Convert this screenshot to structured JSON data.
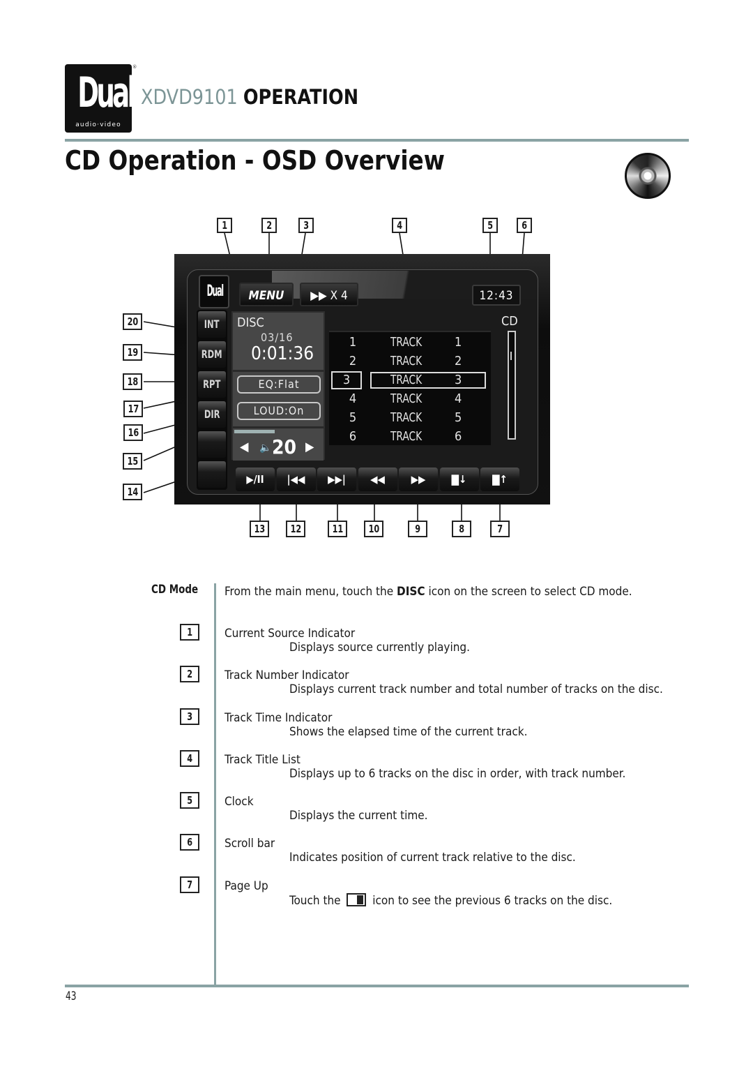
{
  "header": {
    "brand": "Dual",
    "brand_sub": "audio·video",
    "registered_mark": "®",
    "model": "XDVD9101",
    "section": "OPERATION",
    "page_title": "CD Operation - OSD Overview",
    "section_icon": "cd-disc-icon"
  },
  "osd": {
    "logo": "Dual",
    "menu_label": "MENU",
    "ff_icon": "fast-forward-icon",
    "ff_label": "X 4",
    "clock": "12:43",
    "source_badge": "CD",
    "side_buttons": [
      "INT",
      "RDM",
      "RPT",
      "DIR",
      "",
      ""
    ],
    "disc_label": "DISC",
    "track_indicator": "03/16",
    "elapsed_time": "0:01:36",
    "eq_label": "EQ:Flat",
    "loud_label": "LOUD:On",
    "volume": "20",
    "volume_level_fraction": 0.4,
    "tracks": [
      {
        "num": "1",
        "title": "TRACK",
        "idx": "1",
        "selected": false
      },
      {
        "num": "2",
        "title": "TRACK",
        "idx": "2",
        "selected": false
      },
      {
        "num": "3",
        "title": "TRACK",
        "idx": "3",
        "selected": true
      },
      {
        "num": "4",
        "title": "TRACK",
        "idx": "4",
        "selected": false
      },
      {
        "num": "5",
        "title": "TRACK",
        "idx": "5",
        "selected": false
      },
      {
        "num": "6",
        "title": "TRACK",
        "idx": "6",
        "selected": false
      }
    ],
    "scroll_position_fraction": 0.2,
    "controls": [
      {
        "name": "play-pause",
        "glyph": "▶/II"
      },
      {
        "name": "previous-track",
        "glyph": "|◀◀"
      },
      {
        "name": "next-track",
        "glyph": "▶▶|"
      },
      {
        "name": "rewind",
        "glyph": "◀◀"
      },
      {
        "name": "fast-forward",
        "glyph": "▶▶"
      },
      {
        "name": "page-down",
        "glyph": "▇↓"
      },
      {
        "name": "page-up",
        "glyph": "▇↑"
      }
    ]
  },
  "callouts": {
    "top": [
      "1",
      "2",
      "3",
      "4",
      "5",
      "6"
    ],
    "bottom": [
      "13",
      "12",
      "11",
      "10",
      "9",
      "8",
      "7"
    ],
    "left": [
      "20",
      "19",
      "18",
      "17",
      "16",
      "15",
      "14"
    ]
  },
  "description": {
    "mode_label": "CD Mode",
    "intro_prefix": "From the main menu, touch the ",
    "intro_bold": "DISC",
    "intro_suffix": " icon on the screen to select CD mode.",
    "items": [
      {
        "num": "1",
        "title": "Current Source Indicator",
        "desc": "Displays source currently playing."
      },
      {
        "num": "2",
        "title": "Track Number Indicator",
        "desc": "Displays current track number and total number of tracks on the disc."
      },
      {
        "num": "3",
        "title": "Track Time Indicator",
        "desc": "Shows the elapsed time of the current track."
      },
      {
        "num": "4",
        "title": "Track Title List",
        "desc": "Displays up to 6 tracks on the disc in order, with track number."
      },
      {
        "num": "5",
        "title": "Clock",
        "desc": "Displays the current time."
      },
      {
        "num": "6",
        "title": "Scroll bar",
        "desc": "Indicates position of current track relative to the disc."
      },
      {
        "num": "7",
        "title": "Page Up",
        "desc_prefix": "Touch the ",
        "desc_suffix": " icon to see the previous 6 tracks on the disc."
      }
    ]
  },
  "footer": {
    "page_number": "43"
  }
}
